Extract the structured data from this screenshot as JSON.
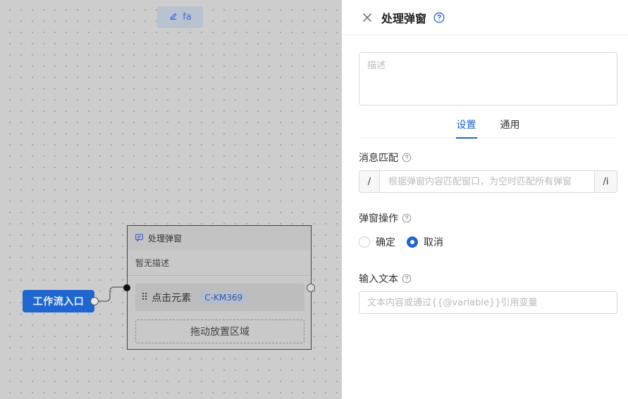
{
  "canvas": {
    "title_pill": {
      "icon": "edit-icon",
      "label": "fa"
    },
    "entry_node": {
      "label": "工作流入口"
    },
    "popup_node": {
      "icon": "message-icon",
      "title": "处理弹窗",
      "description": "暂无描述",
      "step": {
        "label": "点击元素",
        "tag": "C-KM369"
      },
      "dropzone_label": "拖动放置区域"
    }
  },
  "drawer": {
    "title": "处理弹窗",
    "description_placeholder": "描述",
    "tabs": [
      {
        "label": "设置",
        "active": true
      },
      {
        "label": "通用",
        "active": false
      }
    ],
    "match": {
      "label": "消息匹配",
      "prefix": "/",
      "suffix": "/i",
      "placeholder": "根据弹窗内容匹配窗口，为空时匹配所有弹窗"
    },
    "operation": {
      "label": "弹窗操作",
      "options": [
        {
          "label": "确定",
          "selected": false
        },
        {
          "label": "取消",
          "selected": true
        }
      ]
    },
    "input_text": {
      "label": "输入文本",
      "placeholder": "文本内容或通过{{@variable}}引用变量"
    }
  },
  "colors": {
    "accent": "#1f66d0",
    "overlay_canvas": "#cdcdcd"
  }
}
